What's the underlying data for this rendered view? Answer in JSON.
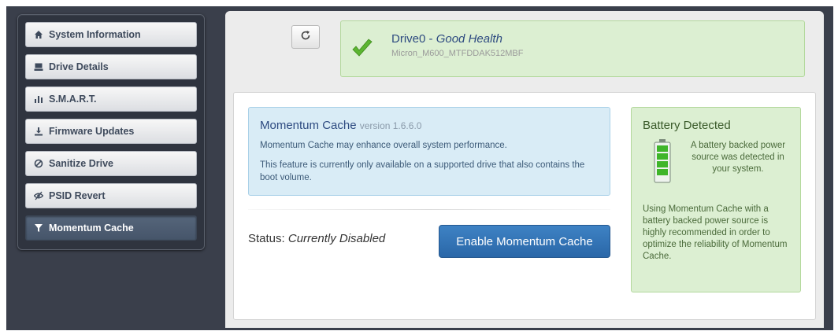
{
  "sidebar": {
    "items": [
      {
        "label": "System Information",
        "icon": "home-icon",
        "active": false
      },
      {
        "label": "Drive Details",
        "icon": "drive-icon",
        "active": false
      },
      {
        "label": "S.M.A.R.T.",
        "icon": "bar-chart-icon",
        "active": false
      },
      {
        "label": "Firmware Updates",
        "icon": "download-icon",
        "active": false
      },
      {
        "label": "Sanitize Drive",
        "icon": "ban-icon",
        "active": false
      },
      {
        "label": "PSID Revert",
        "icon": "eye-slash-icon",
        "active": false
      },
      {
        "label": "Momentum Cache",
        "icon": "filter-icon",
        "active": true
      }
    ]
  },
  "drive": {
    "name": "Drive0",
    "separator": " - ",
    "health": "Good Health",
    "model": "Micron_M600_MTFDDAK512MBF"
  },
  "momentum": {
    "title": "Momentum Cache",
    "version": "version 1.6.6.0",
    "line1": "Momentum Cache may enhance overall system performance.",
    "line2": "This feature is currently only available on a supported drive that also contains the boot volume.",
    "status_label": "Status:",
    "status_value": "Currently Disabled",
    "enable_label": "Enable Momentum Cache"
  },
  "battery": {
    "title": "Battery Detected",
    "text1": "A battery backed power source was detected in your system.",
    "text2": "Using Momentum Cache with a battery backed power source is highly recommended in order to optimize the reliability of Momentum Cache."
  },
  "colors": {
    "success": "#5cb531",
    "primary": "#2a67a8",
    "info_bg": "#d9ecf6",
    "success_bg": "#dcefd2"
  }
}
